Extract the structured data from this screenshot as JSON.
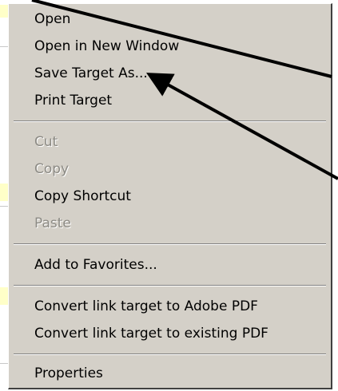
{
  "background_text": "",
  "context_menu": {
    "items": [
      {
        "label": "Open",
        "enabled": true
      },
      {
        "label": "Open in New Window",
        "enabled": true
      },
      {
        "label": "Save Target As...",
        "enabled": true
      },
      {
        "label": "Print Target",
        "enabled": true
      },
      {
        "label": "Cut",
        "enabled": false
      },
      {
        "label": "Copy",
        "enabled": false
      },
      {
        "label": "Copy Shortcut",
        "enabled": true
      },
      {
        "label": "Paste",
        "enabled": false
      },
      {
        "label": "Add to Favorites...",
        "enabled": true
      },
      {
        "label": "Convert link target to Adobe PDF",
        "enabled": true
      },
      {
        "label": "Convert link target to existing PDF",
        "enabled": true
      },
      {
        "label": "Properties",
        "enabled": true
      }
    ]
  },
  "colors": {
    "menu_bg": "#d4d0c8",
    "disabled_text": "#8c8a84",
    "arrow": "#000000"
  },
  "icons": [
    "arrow-pointer-icon",
    "arrow-pointer-icon"
  ]
}
